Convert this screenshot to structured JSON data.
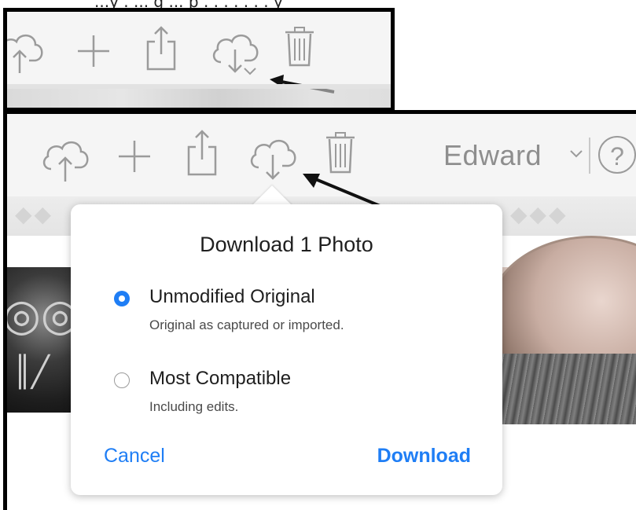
{
  "caption": {
    "text": "...y . ... g ... p . . . . . . . y"
  },
  "toolbar": {
    "icons": [
      "upload-cloud-icon",
      "plus-icon",
      "share-icon",
      "download-cloud-icon",
      "trash-icon"
    ]
  },
  "account": {
    "username": "Edward",
    "help_glyph": "?"
  },
  "dialog": {
    "title": "Download 1 Photo",
    "options": [
      {
        "label": "Unmodified Original",
        "description": "Original as captured or imported.",
        "selected": true
      },
      {
        "label": "Most Compatible",
        "description": "Including edits.",
        "selected": false
      }
    ],
    "cancel_label": "Cancel",
    "download_label": "Download"
  },
  "colors": {
    "accent": "#1f7ef5",
    "icon_gray": "#9b9b9b",
    "toolbar_bg": "#f5f5f5"
  }
}
